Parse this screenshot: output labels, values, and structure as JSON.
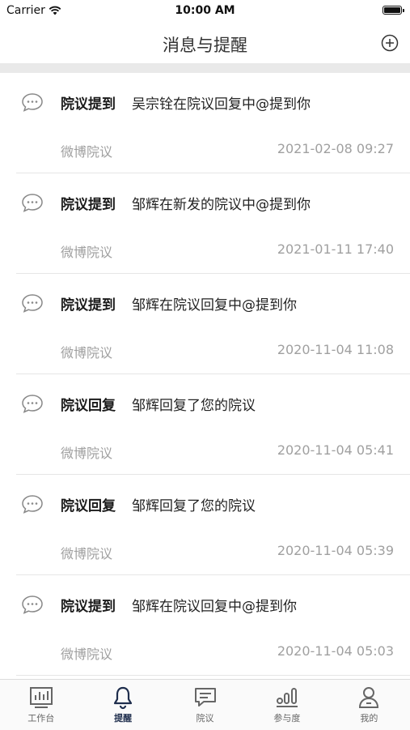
{
  "status": {
    "carrier": "Carrier",
    "time": "10:00 AM"
  },
  "nav": {
    "title": "消息与提醒"
  },
  "messages": [
    {
      "type": "院议提到",
      "content": "吴宗铨在院议回复中@提到你",
      "source": "微博院议",
      "time": "2021-02-08 09:27"
    },
    {
      "type": "院议提到",
      "content": "邹辉在新发的院议中@提到你",
      "source": "微博院议",
      "time": "2021-01-11 17:40"
    },
    {
      "type": "院议提到",
      "content": "邹辉在院议回复中@提到你",
      "source": "微博院议",
      "time": "2020-11-04 11:08"
    },
    {
      "type": "院议回复",
      "content": "邹辉回复了您的院议",
      "source": "微博院议",
      "time": "2020-11-04 05:41"
    },
    {
      "type": "院议回复",
      "content": "邹辉回复了您的院议",
      "source": "微博院议",
      "time": "2020-11-04 05:39"
    },
    {
      "type": "院议提到",
      "content": "邹辉在院议回复中@提到你",
      "source": "微博院议",
      "time": "2020-11-04 05:03"
    }
  ],
  "tabs": [
    {
      "label": "工作台",
      "icon": "chart-icon",
      "active": false
    },
    {
      "label": "提醒",
      "icon": "bell-icon",
      "active": true
    },
    {
      "label": "院议",
      "icon": "chat-icon",
      "active": false
    },
    {
      "label": "参与度",
      "icon": "bars-icon",
      "active": false
    },
    {
      "label": "我的",
      "icon": "person-icon",
      "active": false
    }
  ],
  "colors": {
    "accent": "#1f2e4d",
    "muted": "#a0a0a0",
    "separator": "#e9e9e9"
  }
}
